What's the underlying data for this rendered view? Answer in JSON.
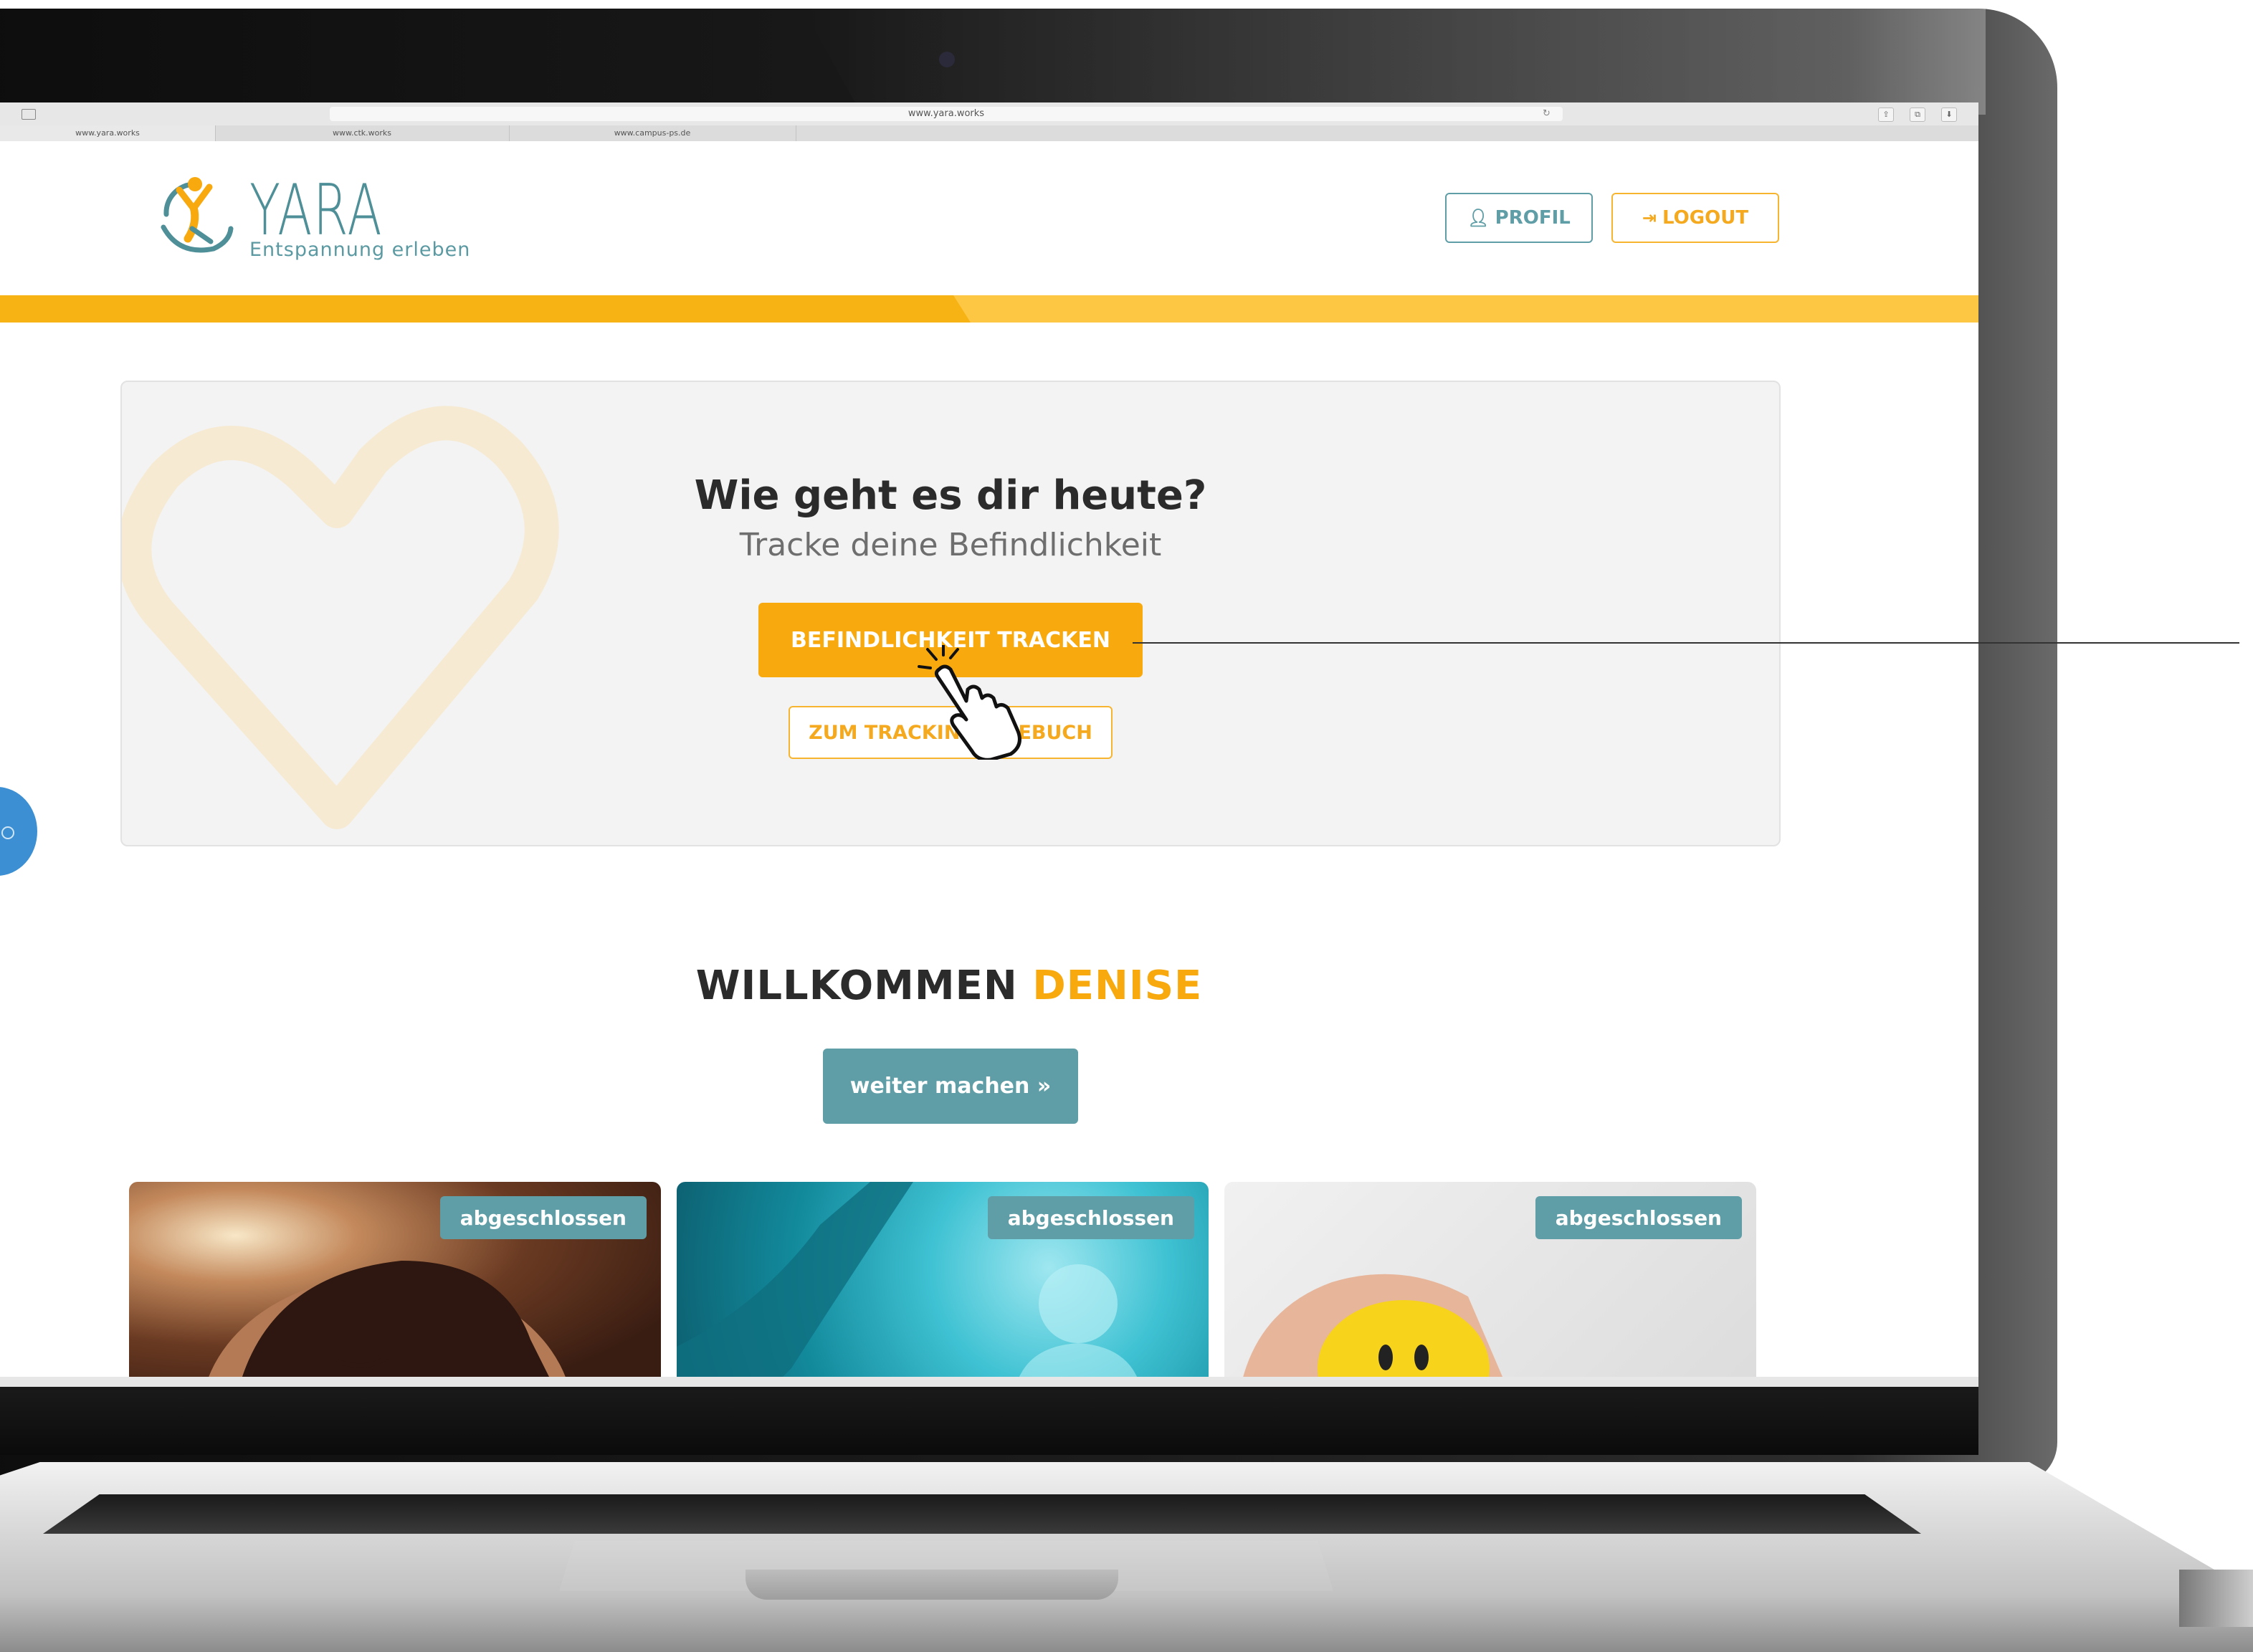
{
  "browser": {
    "url": "www.yara.works",
    "tabs": [
      "www.yara.works",
      "www.ctk.works",
      "www.campus-ps.de"
    ]
  },
  "header": {
    "logo_text": "YARA",
    "tagline": "Entspannung erleben",
    "profil_label": "PROFIL",
    "logout_label": "LOGOUT",
    "profil_icon": "user-icon",
    "logout_icon": "sign-out-icon"
  },
  "tracking": {
    "title": "Wie geht es dir heute?",
    "subtitle": "Tracke deine Befindlichkeit",
    "track_button": "BEFINDLICHKEIT TRACKEN",
    "diary_button": "ZUM TRACKINGTAGEBUCH"
  },
  "welcome": {
    "prefix": "WILLKOMMEN",
    "name": "DENISE",
    "continue_button": "weiter machen »"
  },
  "courses": [
    {
      "badge": "abgeschlossen"
    },
    {
      "badge": "abgeschlossen"
    },
    {
      "badge": "abgeschlossen"
    }
  ],
  "colors": {
    "accent_orange": "#f7a90e",
    "teal": "#5f9ea6",
    "stripe_light": "#fdc744"
  }
}
